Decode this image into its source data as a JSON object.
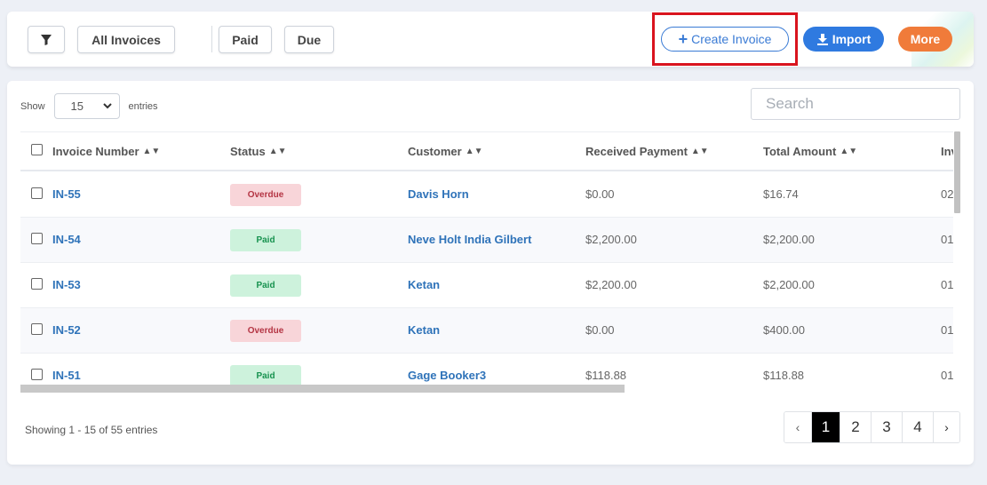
{
  "toolbar": {
    "all_invoices": "All Invoices",
    "paid": "Paid",
    "due": "Due",
    "create_invoice": "Create Invoice",
    "import": "Import",
    "more": "More"
  },
  "controls": {
    "show_label": "Show",
    "entries_label": "entries",
    "page_size": "15",
    "search_placeholder": "Search"
  },
  "table": {
    "headers": [
      "Invoice Number",
      "Status",
      "Customer",
      "Received Payment",
      "Total Amount",
      "Inv"
    ],
    "rows": [
      {
        "invoice": "IN-55",
        "status": "Overdue",
        "customer": "Davis Horn",
        "received": "$0.00",
        "total": "$16.74",
        "date": "02"
      },
      {
        "invoice": "IN-54",
        "status": "Paid",
        "customer": "Neve Holt India Gilbert",
        "received": "$2,200.00",
        "total": "$2,200.00",
        "date": "01"
      },
      {
        "invoice": "IN-53",
        "status": "Paid",
        "customer": "Ketan",
        "received": "$2,200.00",
        "total": "$2,200.00",
        "date": "01"
      },
      {
        "invoice": "IN-52",
        "status": "Overdue",
        "customer": "Ketan",
        "received": "$0.00",
        "total": "$400.00",
        "date": "01"
      },
      {
        "invoice": "IN-51",
        "status": "Paid",
        "customer": "Gage Booker3",
        "received": "$118.88",
        "total": "$118.88",
        "date": "01"
      }
    ]
  },
  "footer": {
    "info": "Showing 1 - 15 of 55 entries",
    "pages": [
      "‹",
      "1",
      "2",
      "3",
      "4",
      "›"
    ],
    "active_page": "1"
  },
  "colors": {
    "primary": "#2f7ae0",
    "accent_orange": "#f07b3a",
    "highlight_red": "#d9141e"
  }
}
